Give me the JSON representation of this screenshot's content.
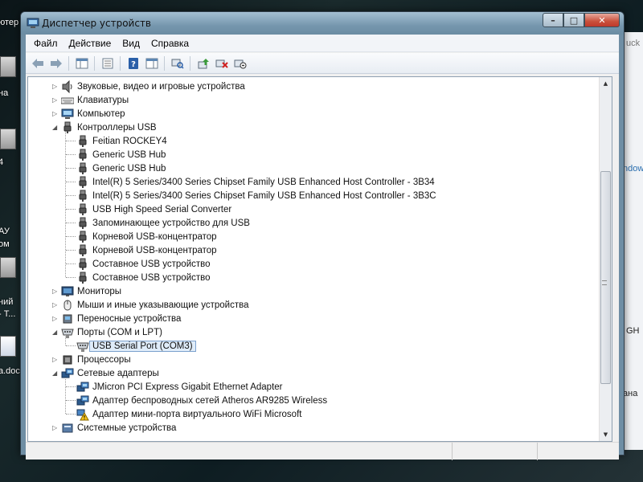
{
  "window": {
    "title": "Диспетчер устройств",
    "buttons": {
      "minimize": "–",
      "maximize": "□",
      "close": "✕"
    }
  },
  "menubar": {
    "items": [
      "Файл",
      "Действие",
      "Вид",
      "Справка"
    ]
  },
  "toolbar": {
    "buttons": [
      "back-icon",
      "forward-icon",
      "show-hide-console-tree-icon",
      "properties-icon",
      "help-icon",
      "action-pane-icon",
      "scan-hardware-icon",
      "update-driver-icon",
      "uninstall-icon",
      "disable-icon"
    ]
  },
  "desktop": {
    "left_labels": [
      "ютер",
      "на",
      "4",
      "АУ",
      "ом",
      "ний",
      "- Т...",
      "a.doc"
    ],
    "right_labels": [
      "uck",
      "ndow",
      "GH",
      "ана"
    ]
  },
  "tree": {
    "items": [
      {
        "label": "Звуковые, видео и игровые устройства",
        "level": 0,
        "expanded": false,
        "icon": "speaker-icon"
      },
      {
        "label": "Клавиатуры",
        "level": 0,
        "expanded": false,
        "icon": "keyboard-icon"
      },
      {
        "label": "Компьютер",
        "level": 0,
        "expanded": false,
        "icon": "computer-icon"
      },
      {
        "label": "Контроллеры USB",
        "level": 0,
        "expanded": true,
        "icon": "usb-plug-icon"
      },
      {
        "label": "Feitian ROCKEY4",
        "level": 1,
        "icon": "usb-plug-icon"
      },
      {
        "label": "Generic USB Hub",
        "level": 1,
        "icon": "usb-plug-icon"
      },
      {
        "label": "Generic USB Hub",
        "level": 1,
        "icon": "usb-plug-icon"
      },
      {
        "label": "Intel(R) 5 Series/3400 Series Chipset Family USB Enhanced Host Controller - 3B34",
        "level": 1,
        "icon": "usb-plug-icon"
      },
      {
        "label": "Intel(R) 5 Series/3400 Series Chipset Family USB Enhanced Host Controller - 3B3C",
        "level": 1,
        "icon": "usb-plug-icon"
      },
      {
        "label": "USB High Speed Serial Converter",
        "level": 1,
        "icon": "usb-plug-icon"
      },
      {
        "label": "Запоминающее устройство для USB",
        "level": 1,
        "icon": "usb-plug-icon"
      },
      {
        "label": "Корневой USB-концентратор",
        "level": 1,
        "icon": "usb-plug-icon"
      },
      {
        "label": "Корневой USB-концентратор",
        "level": 1,
        "icon": "usb-plug-icon"
      },
      {
        "label": "Составное USB устройство",
        "level": 1,
        "icon": "usb-plug-icon"
      },
      {
        "label": "Составное USB устройство",
        "level": 1,
        "icon": "usb-plug-icon"
      },
      {
        "label": "Мониторы",
        "level": 0,
        "expanded": false,
        "icon": "monitor-icon"
      },
      {
        "label": "Мыши и иные указывающие устройства",
        "level": 0,
        "expanded": false,
        "icon": "mouse-icon"
      },
      {
        "label": "Переносные устройства",
        "level": 0,
        "expanded": false,
        "icon": "portable-device-icon"
      },
      {
        "label": "Порты (COM и LPT)",
        "level": 0,
        "expanded": true,
        "icon": "port-icon"
      },
      {
        "label": "USB Serial Port (COM3)",
        "level": 1,
        "icon": "port-icon",
        "selected": true
      },
      {
        "label": "Процессоры",
        "level": 0,
        "expanded": false,
        "icon": "processor-icon"
      },
      {
        "label": "Сетевые адаптеры",
        "level": 0,
        "expanded": true,
        "icon": "network-adapter-icon"
      },
      {
        "label": "JMicron PCI Express Gigabit Ethernet Adapter",
        "level": 1,
        "icon": "network-adapter-icon"
      },
      {
        "label": "Адаптер беспроводных сетей Atheros AR9285 Wireless",
        "level": 1,
        "icon": "network-adapter-icon"
      },
      {
        "label": "Адаптер мини-порта виртуального WiFi Microsoft",
        "level": 1,
        "icon": "network-adapter-warning-icon"
      },
      {
        "label": "Системные устройства",
        "level": 0,
        "expanded": false,
        "icon": "system-device-icon"
      }
    ]
  },
  "colors": {
    "titlebar": "#7697ae",
    "selection_bg": "#dfecf9",
    "selection_border": "#7da2ce",
    "close_button": "#c9503b"
  }
}
